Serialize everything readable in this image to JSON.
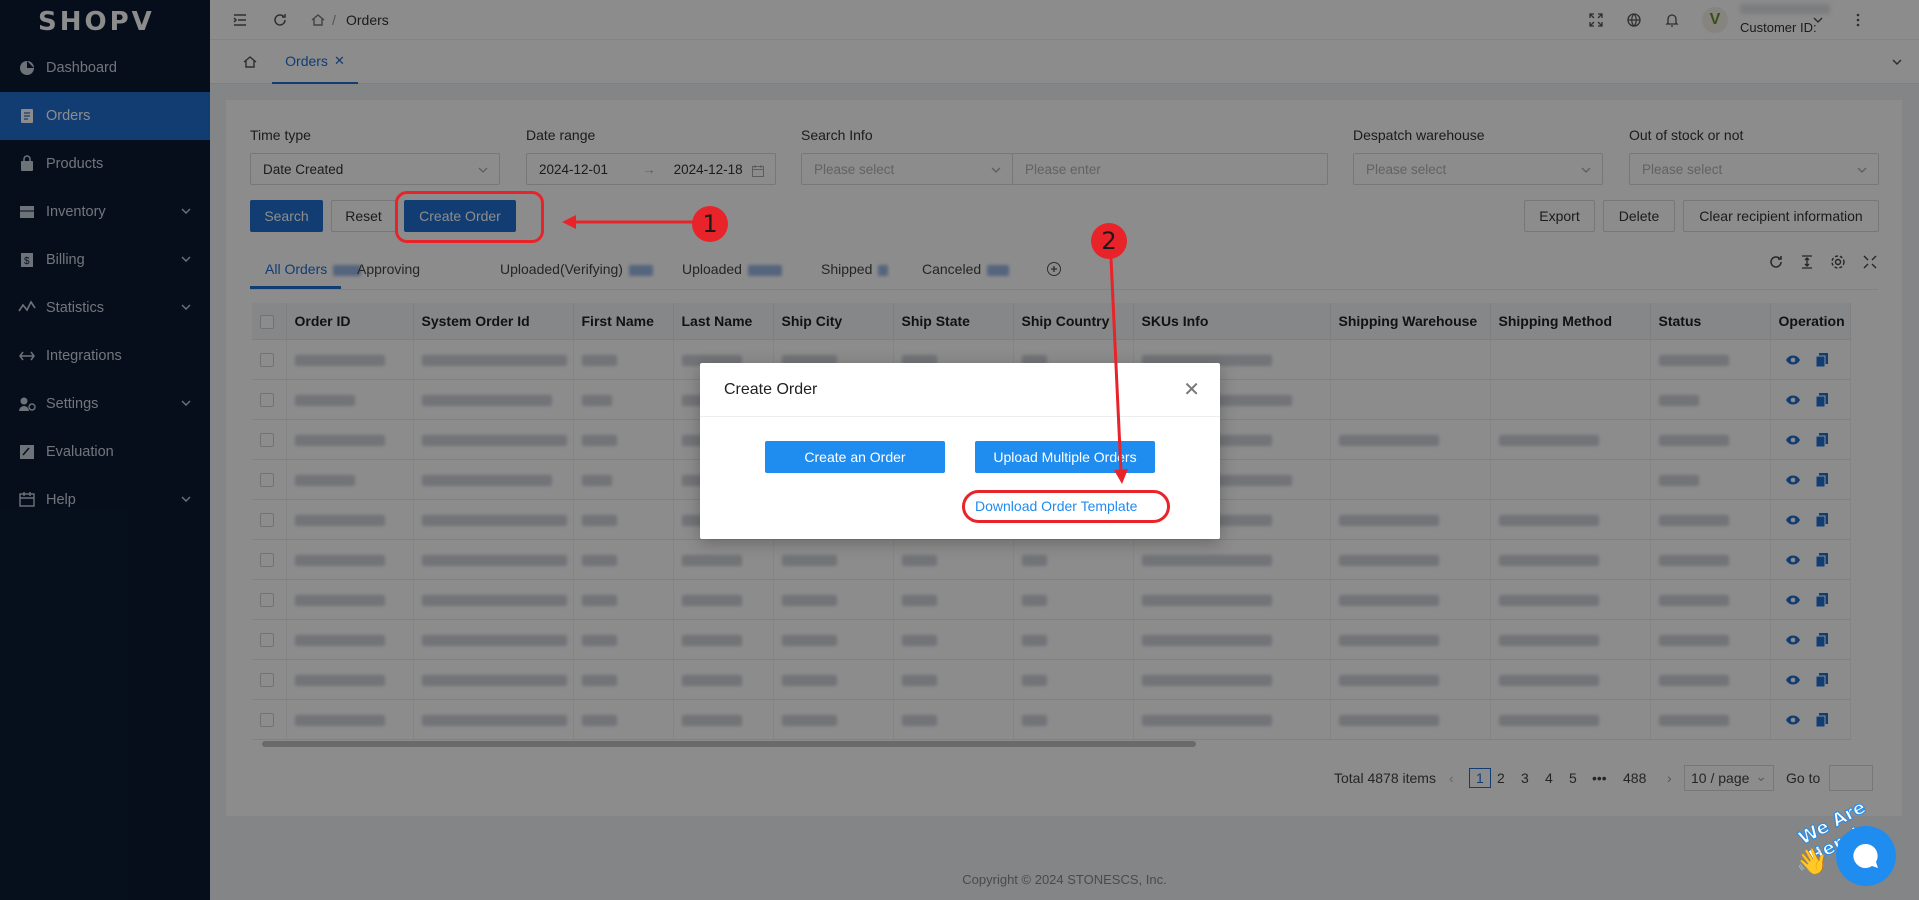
{
  "brand": "SHOPV",
  "sidebar": {
    "items": [
      {
        "label": "Dashboard",
        "icon": "dashboard-icon",
        "expandable": false,
        "active": false
      },
      {
        "label": "Orders",
        "icon": "orders-icon",
        "expandable": false,
        "active": true
      },
      {
        "label": "Products",
        "icon": "products-icon",
        "expandable": false,
        "active": false
      },
      {
        "label": "Inventory",
        "icon": "inventory-icon",
        "expandable": true,
        "active": false
      },
      {
        "label": "Billing",
        "icon": "billing-icon",
        "expandable": true,
        "active": false
      },
      {
        "label": "Statistics",
        "icon": "statistics-icon",
        "expandable": true,
        "active": false
      },
      {
        "label": "Integrations",
        "icon": "integrations-icon",
        "expandable": false,
        "active": false
      },
      {
        "label": "Settings",
        "icon": "settings-icon",
        "expandable": true,
        "active": false
      },
      {
        "label": "Evaluation",
        "icon": "evaluation-icon",
        "expandable": false,
        "active": false
      },
      {
        "label": "Help",
        "icon": "help-icon",
        "expandable": true,
        "active": false
      }
    ]
  },
  "header": {
    "breadcrumb": "Orders",
    "customer_label": "Customer ID:",
    "avatar_letter": "V"
  },
  "tabs": {
    "active_tab": "Orders"
  },
  "filters": {
    "time_type_label": "Time type",
    "time_type_value": "Date Created",
    "date_range_label": "Date range",
    "date_start": "2024-12-01",
    "date_end": "2024-12-18",
    "search_info_label": "Search Info",
    "search_select_placeholder": "Please select",
    "search_input_placeholder": "Please enter",
    "despatch_label": "Despatch warehouse",
    "despatch_placeholder": "Please select",
    "stock_label": "Out of stock or not",
    "stock_placeholder": "Please select"
  },
  "actions": {
    "search": "Search",
    "reset": "Reset",
    "create_order": "Create Order",
    "export": "Export",
    "delete": "Delete",
    "clear_recipient": "Clear recipient information"
  },
  "status_tabs": [
    "All Orders",
    "Approving",
    "Uploaded(Verifying)",
    "Uploaded",
    "Shipped",
    "Canceled"
  ],
  "table": {
    "columns": [
      "Order ID",
      "System Order Id",
      "First Name",
      "Last Name",
      "Ship City",
      "Ship State",
      "Ship Country",
      "SKUs Info",
      "Shipping Warehouse",
      "Shipping Method",
      "Status",
      "Operation"
    ],
    "row_count": 10
  },
  "pagination": {
    "total": "Total 4878 items",
    "pages": [
      "1",
      "2",
      "3",
      "4",
      "5",
      "•••",
      "488"
    ],
    "current": "1",
    "page_size": "10 / page",
    "goto_label": "Go to"
  },
  "modal": {
    "title": "Create Order",
    "create_one": "Create an Order",
    "upload_multiple": "Upload Multiple Orders",
    "download_template": "Download Order Template"
  },
  "annotations": {
    "step1": "1",
    "step2": "2",
    "color": "#e8232a"
  },
  "footer": "Copyright © 2024 STONESCS, Inc.",
  "chat_badge": "We Are Here!",
  "colors": {
    "sidebar_bg": "#0b1b33",
    "primary": "#1f6fd1",
    "modal_button": "#1f8cf0"
  }
}
